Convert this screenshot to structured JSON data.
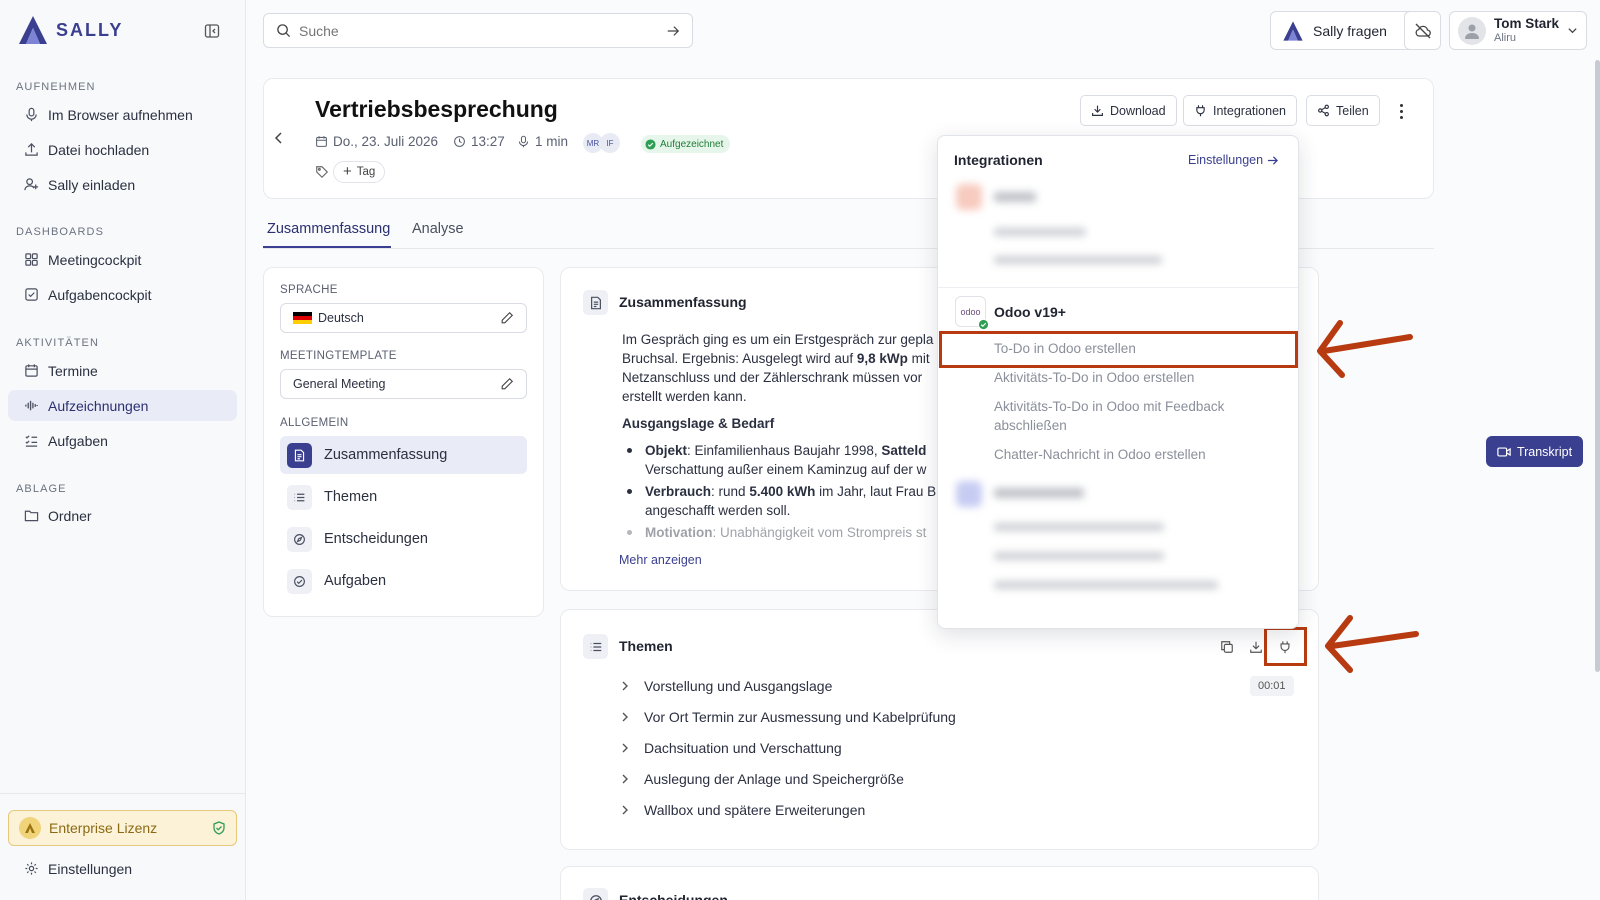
{
  "app": {
    "name": "SALLY"
  },
  "sidebar": {
    "sections": [
      {
        "title": "AUFNEHMEN",
        "items": [
          {
            "label": "Im Browser aufnehmen",
            "icon": "mic-icon"
          },
          {
            "label": "Datei hochladen",
            "icon": "upload-icon"
          },
          {
            "label": "Sally einladen",
            "icon": "user-plus-icon"
          }
        ]
      },
      {
        "title": "DASHBOARDS",
        "items": [
          {
            "label": "Meetingcockpit",
            "icon": "grid-icon"
          },
          {
            "label": "Aufgabencockpit",
            "icon": "checkbox-icon"
          }
        ]
      },
      {
        "title": "AKTIVITÄTEN",
        "items": [
          {
            "label": "Termine",
            "icon": "calendar-icon"
          },
          {
            "label": "Aufzeichnungen",
            "icon": "waveform-icon",
            "active": true
          },
          {
            "label": "Aufgaben",
            "icon": "checklist-icon"
          }
        ]
      },
      {
        "title": "ABLAGE",
        "items": [
          {
            "label": "Ordner",
            "icon": "folder-icon"
          }
        ]
      }
    ],
    "license": "Enterprise Lizenz",
    "settings": "Einstellungen"
  },
  "header": {
    "search_placeholder": "Suche",
    "ask_sally": "Sally fragen",
    "user": {
      "name": "Tom Stark",
      "org": "Aliru"
    }
  },
  "meeting": {
    "title": "Vertriebsbesprechung",
    "date": "Do., 23. Juli 2026",
    "time": "13:27",
    "duration": "1 min",
    "participants": [
      "MR",
      "IF"
    ],
    "status": "Aufgezeichnet",
    "tag_button": "Tag",
    "actions": {
      "download": "Download",
      "integrations": "Integrationen",
      "share": "Teilen"
    }
  },
  "tabs": [
    {
      "label": "Zusammenfassung",
      "active": true
    },
    {
      "label": "Analyse"
    }
  ],
  "left_panel": {
    "language_label": "SPRACHE",
    "language_value": "Deutsch",
    "template_label": "MEETINGTEMPLATE",
    "template_value": "General Meeting",
    "general_label": "ALLGEMEIN",
    "items": [
      {
        "label": "Zusammenfassung",
        "active": true
      },
      {
        "label": "Themen"
      },
      {
        "label": "Entscheidungen"
      },
      {
        "label": "Aufgaben"
      }
    ]
  },
  "summary": {
    "heading": "Zusammenfassung",
    "para_line1": "Im Gespräch ging es um ein Erstgespräch zur gepla",
    "para_line2_pre": "Bruchsal. Ergebnis: Ausgelegt wird auf ",
    "para_line2_bold": "9,8 kWp",
    "para_line2_post": " mit",
    "para_line3": "Netzanschluss und der Zählerschrank müssen vor",
    "para_line4": "erstellt werden kann.",
    "subheading": "Ausgangslage & Bedarf",
    "bullet1_bold": "Objekt",
    "bullet1_text": ": Einfamilienhaus Baujahr 1998, ",
    "bullet1_bold2": "Satteld",
    "bullet1_line2": "Verschattung außer einem Kaminzug auf der w",
    "bullet2_bold": "Verbrauch",
    "bullet2_text": ": rund ",
    "bullet2_bold2": "5.400 kWh",
    "bullet2_text2": " im Jahr, laut Frau B",
    "bullet2_line2": "angeschafft werden soll.",
    "bullet3_bold": "Motivation",
    "bullet3_text": ": Unabhängigkeit vom Strompreis st",
    "more": "Mehr anzeigen"
  },
  "topics": {
    "heading": "Themen",
    "timestamp": "00:01",
    "items": [
      "Vorstellung und Ausgangslage",
      "Vor Ort Termin zur Ausmessung und Kabelprüfung",
      "Dachsituation und Verschattung",
      "Auslegung der Anlage und Speichergröße",
      "Wallbox und spätere Erweiterungen"
    ]
  },
  "decisions": {
    "heading": "Entscheidungen"
  },
  "integrations_menu": {
    "title": "Integrationen",
    "settings_link": "Einstellungen",
    "odoo": {
      "name": "Odoo v19+",
      "logo_text": "odoo",
      "actions": [
        "To-Do in Odoo erstellen",
        "Aktivitäts-To-Do in Odoo erstellen",
        "Aktivitäts-To-Do in Odoo mit Feedback",
        "abschließen",
        "Chatter-Nachricht in Odoo erstellen"
      ]
    }
  },
  "transcript_button": "Transkript",
  "colors": {
    "accent": "#3a3f8f",
    "highlight": "#b83a10",
    "success": "#1e7d36"
  }
}
